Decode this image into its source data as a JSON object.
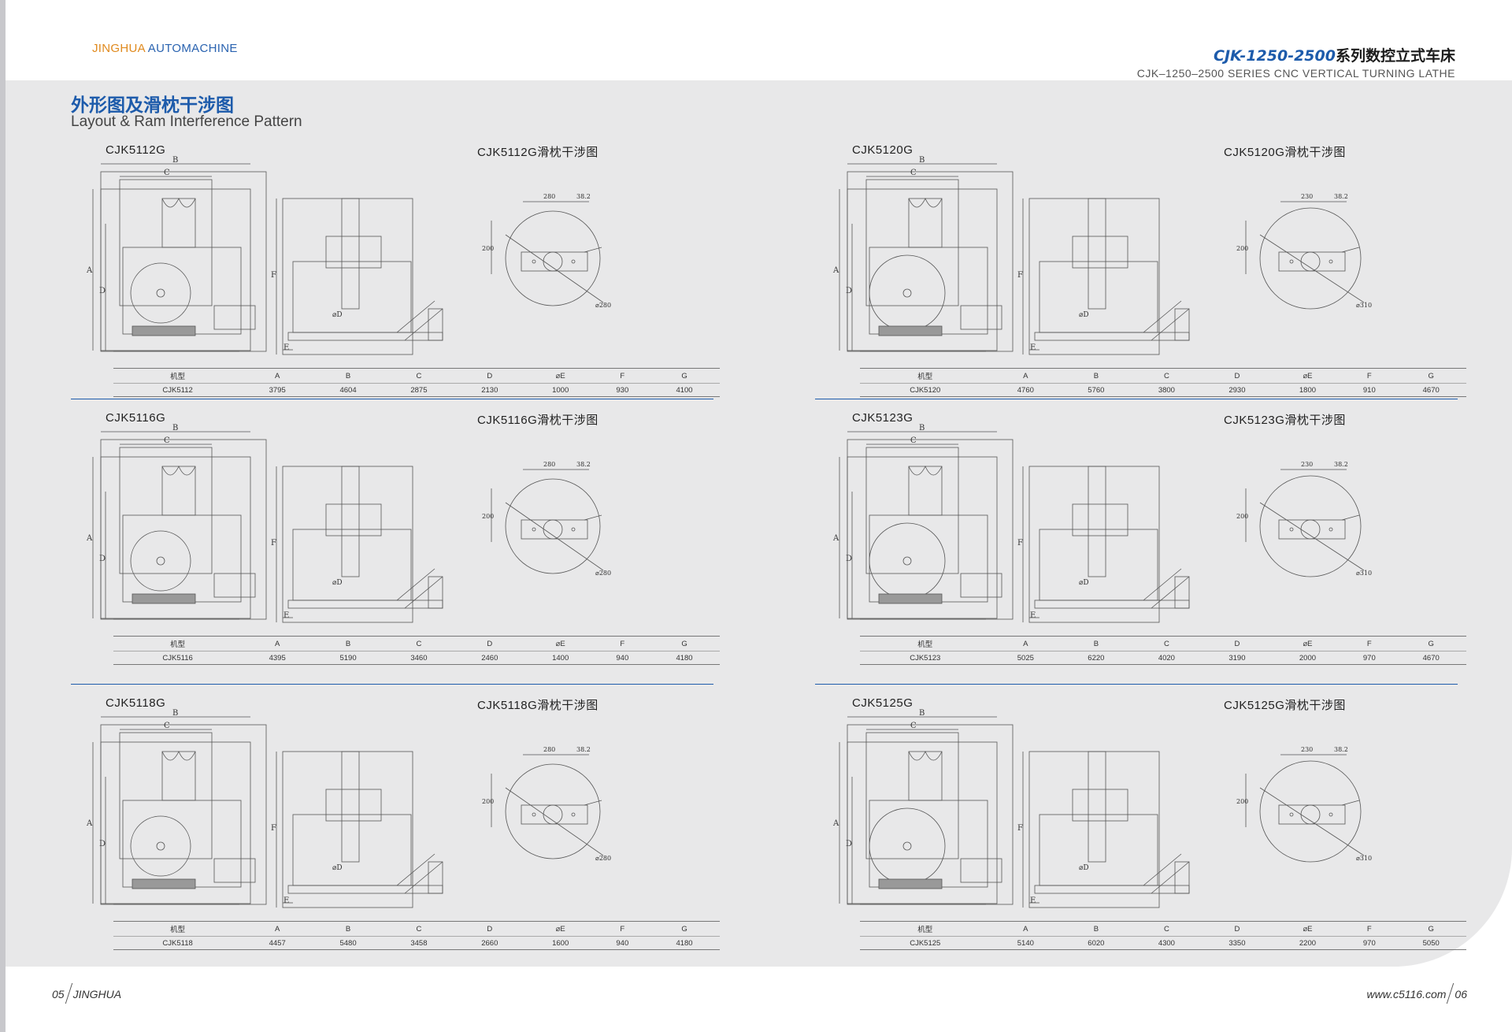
{
  "header": {
    "brand_part1": "JINGHUA",
    "brand_part2": "AUTOMACHINE",
    "title_code": "CJK-1250-2500",
    "title_cn": "系列数控立式车床",
    "subtitle": "CJK–1250–2500 SERIES CNC VERTICAL TURNING LATHE"
  },
  "section": {
    "title": "外形图及滑枕干涉图",
    "subtitle": "Layout & Ram Interference Pattern"
  },
  "table_headers": [
    "机型",
    "A",
    "B",
    "C",
    "D",
    "⌀E",
    "F",
    "G"
  ],
  "drawing_labels": {
    "a": "A",
    "b": "B",
    "c": "C",
    "d": "D",
    "e": "E",
    "f": "F",
    "od": "⌀D",
    "dim_w_small": "280",
    "dim_w_large": "230",
    "dim_off": "38.2",
    "dim_h": "200",
    "dia_small": "⌀280",
    "dia_large": "⌀310"
  },
  "panels": [
    {
      "model": "CJK5112G",
      "ram": "CJK5112G滑枕干涉图",
      "values": [
        "CJK5112",
        "3795",
        "4604",
        "2875",
        "2130",
        "1000",
        "930",
        "4100"
      ]
    },
    {
      "model": "CJK5120G",
      "ram": "CJK5120G滑枕干涉图",
      "values": [
        "CJK5120",
        "4760",
        "5760",
        "3800",
        "2930",
        "1800",
        "910",
        "4670"
      ]
    },
    {
      "model": "CJK5116G",
      "ram": "CJK5116G滑枕干涉图",
      "values": [
        "CJK5116",
        "4395",
        "5190",
        "3460",
        "2460",
        "1400",
        "940",
        "4180"
      ]
    },
    {
      "model": "CJK5123G",
      "ram": "CJK5123G滑枕干涉图",
      "values": [
        "CJK5123",
        "5025",
        "6220",
        "4020",
        "3190",
        "2000",
        "970",
        "4670"
      ]
    },
    {
      "model": "CJK5118G",
      "ram": "CJK5118G滑枕干涉图",
      "values": [
        "CJK5118",
        "4457",
        "5480",
        "3458",
        "2660",
        "1600",
        "940",
        "4180"
      ]
    },
    {
      "model": "CJK5125G",
      "ram": "CJK5125G滑枕干涉图",
      "values": [
        "CJK5125",
        "5140",
        "6020",
        "4300",
        "3350",
        "2200",
        "970",
        "5050"
      ]
    }
  ],
  "footer": {
    "left_page": "05",
    "left_brand": "JINGHUA",
    "right_url": "www.c5116.com",
    "right_page": "06"
  }
}
